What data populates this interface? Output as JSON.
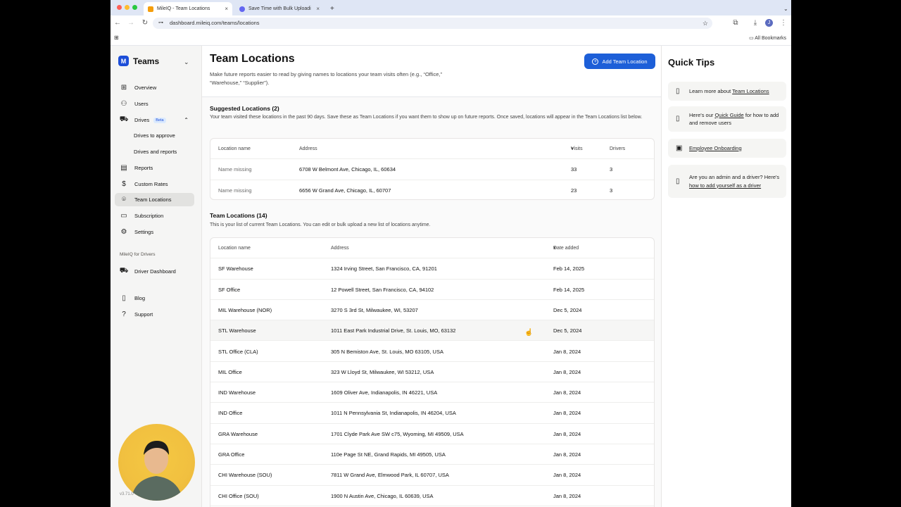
{
  "browser": {
    "tabs": [
      {
        "title": "MileIQ - Team Locations",
        "active": true
      },
      {
        "title": "Save Time with Bulk Uploadi",
        "active": false
      }
    ],
    "url": "dashboard.mileiq.com/teams/locations",
    "bookmarks_label": "All Bookmarks"
  },
  "sidebar": {
    "brand": "Teams",
    "items": [
      {
        "label": "Overview",
        "icon": "grid-icon"
      },
      {
        "label": "Users",
        "icon": "users-icon"
      },
      {
        "label": "Drives",
        "icon": "car-icon",
        "badge": "Beta"
      },
      {
        "label": "Reports",
        "icon": "report-icon"
      },
      {
        "label": "Custom Rates",
        "icon": "dollar-icon"
      },
      {
        "label": "Team Locations",
        "icon": "location-pin-icon",
        "active": true
      },
      {
        "label": "Subscription",
        "icon": "card-icon"
      },
      {
        "label": "Settings",
        "icon": "gear-icon"
      }
    ],
    "drives_sub": [
      "Drives to approve",
      "Drives and reports"
    ],
    "section_label": "MileIQ for Drivers",
    "driver_items": [
      {
        "label": "Driver Dashboard",
        "icon": "car-icon"
      },
      {
        "label": "Blog",
        "icon": "book-icon"
      },
      {
        "label": "Support",
        "icon": "help-icon"
      }
    ],
    "version": "v3.71.0"
  },
  "main": {
    "title": "Team Locations",
    "subtitle": "Make future reports easier to read by giving names to locations your team visits often (e.g., “Office,” “Warehouse,” “Supplier”).",
    "add_button": "Add Team Location",
    "suggested": {
      "heading": "Suggested Locations (2)",
      "description": "Your team visited these locations in the past 90 days. Save these as Team Locations if you want them to show up on future reports. Once saved, locations will appear in the Team Locations list below.",
      "columns": [
        "Location name",
        "Address",
        "Visits",
        "Drivers"
      ],
      "rows": [
        {
          "name": "Name missing",
          "address": "6708 W Belmont Ave, Chicago, IL, 60634",
          "visits": "33",
          "drivers": "3"
        },
        {
          "name": "Name missing",
          "address": "6656 W Grand Ave, Chicago, IL, 60707",
          "visits": "23",
          "drivers": "3"
        }
      ]
    },
    "locations": {
      "heading": "Team Locations (14)",
      "description": "This is your list of current Team Locations. You can edit or bulk upload a new list of locations anytime.",
      "columns": [
        "Location name",
        "Address",
        "Date added"
      ],
      "rows": [
        {
          "name": "SF Warehouse",
          "address": "1324 Irving Street, San Francisco, CA, 91201",
          "date": "Feb 14, 2025"
        },
        {
          "name": "SF Office",
          "address": "12 Powell Street, San Francisco, CA, 94102",
          "date": "Feb 14, 2025"
        },
        {
          "name": "MIL Warehouse (NOR)",
          "address": "3270 S 3rd St, Milwaukee, WI, 53207",
          "date": "Dec 5, 2024"
        },
        {
          "name": "STL Warehouse",
          "address": "1011 East Park Industrial Drive, St. Louis, MO, 63132",
          "date": "Dec 5, 2024"
        },
        {
          "name": "STL Office (CLA)",
          "address": "305 N Bemiston Ave, St. Louis, MO 63105, USA",
          "date": "Jan 8, 2024"
        },
        {
          "name": "MIL Office",
          "address": "323 W Lloyd St, Milwaukee, WI 53212, USA",
          "date": "Jan 8, 2024"
        },
        {
          "name": "IND Warehouse",
          "address": "1609 Oliver Ave, Indianapolis, IN 46221, USA",
          "date": "Jan 8, 2024"
        },
        {
          "name": "IND Office",
          "address": "1011 N Pennsylvania St, Indianapolis, IN 46204, USA",
          "date": "Jan 8, 2024"
        },
        {
          "name": "GRA Warehouse",
          "address": "1701 Clyde Park Ave SW c75, Wyoming, MI 49509, USA",
          "date": "Jan 8, 2024"
        },
        {
          "name": "GRA Office",
          "address": "110e Page St NE, Grand Rapids, MI 49505, USA",
          "date": "Jan 8, 2024"
        },
        {
          "name": "CHI Warehouse (SOU)",
          "address": "7811 W Grand Ave, Elmwood Park, IL 60707, USA",
          "date": "Jan 8, 2024"
        },
        {
          "name": "CHI Office (SOU)",
          "address": "1900 N Austin Ave, Chicago, IL 60639, USA",
          "date": "Jan 8, 2024"
        }
      ]
    }
  },
  "tips": {
    "title": "Quick Tips",
    "items": [
      {
        "pre": "Learn more about ",
        "link": "Team Locations",
        "post": "",
        "icon": "book-icon"
      },
      {
        "pre": "Here's our ",
        "link": "Quick Guide",
        "post": " for how to add and remove users",
        "icon": "book-icon"
      },
      {
        "pre": "",
        "link": "Employee Onboarding",
        "post": "",
        "icon": "video-icon"
      },
      {
        "pre": "Are you an admin and a driver? Here's ",
        "link": "how to add yourself as a driver",
        "post": "",
        "icon": "book-icon"
      }
    ]
  }
}
